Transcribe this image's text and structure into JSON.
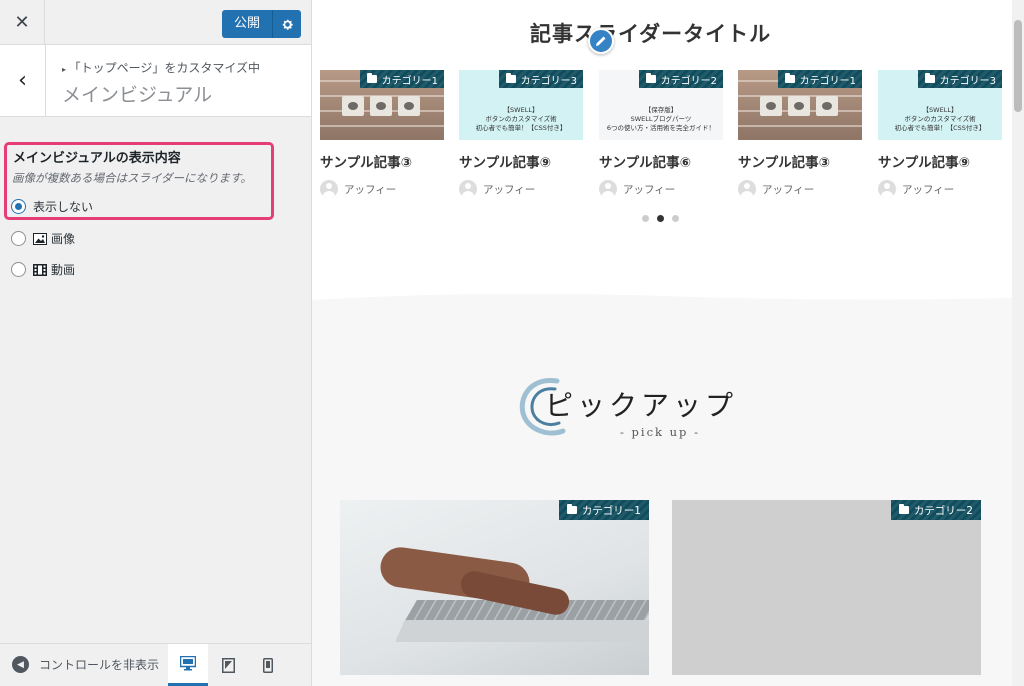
{
  "sidebar": {
    "publish_label": "公開",
    "breadcrumb": "「トップページ」をカスタマイズ中",
    "section_title": "メインビジュアル",
    "control": {
      "label": "メインビジュアルの表示内容",
      "description": "画像が複数ある場合はスライダーになります。",
      "options": [
        {
          "label": "表示しない",
          "checked": true
        },
        {
          "label": "画像",
          "checked": false
        },
        {
          "label": "動画",
          "checked": false
        }
      ]
    },
    "footer": {
      "collapse_label": "コントロールを非表示",
      "devices": [
        "desktop",
        "tablet",
        "mobile"
      ],
      "active_device": "desktop"
    }
  },
  "preview": {
    "slider_title": "記事スライダータイトル",
    "cards": [
      {
        "category": "カテゴリー1",
        "title": "サンプル記事③",
        "author": "アッフィー",
        "thumb": "brick",
        "thumb_text": ""
      },
      {
        "category": "カテゴリー3",
        "title": "サンプル記事⑨",
        "author": "アッフィー",
        "thumb": "swell",
        "thumb_text": "【SWELL】\nボタンのカスタマイズ術\n初心者でも簡単！【CSS付き】"
      },
      {
        "category": "カテゴリー2",
        "title": "サンプル記事⑥",
        "author": "アッフィー",
        "thumb": "plain",
        "thumb_text": "【保存版】\nSWELLブログパーツ\n6つの使い方・活用術を完全ガイド！"
      },
      {
        "category": "カテゴリー1",
        "title": "サンプル記事③",
        "author": "アッフィー",
        "thumb": "brick",
        "thumb_text": ""
      },
      {
        "category": "カテゴリー3",
        "title": "サンプル記事⑨",
        "author": "アッフィー",
        "thumb": "swell",
        "thumb_text": "【SWELL】\nボタンのカスタマイズ術\n初心者でも簡単！【CSS付き】"
      }
    ],
    "slider_dots": {
      "count": 3,
      "active": 1
    },
    "pickup_title": "ピックアップ",
    "pickup_sub": "- pick up -",
    "big_cards": [
      {
        "category": "カテゴリー1"
      },
      {
        "category": "カテゴリー2"
      }
    ]
  },
  "colors": {
    "accent": "#2271b1",
    "highlight_border": "#e53e76",
    "badge": "#0f4c5c"
  }
}
